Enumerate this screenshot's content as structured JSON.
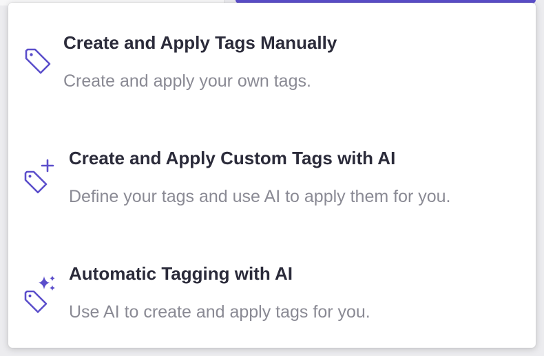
{
  "colors": {
    "accent": "#5b4ecb",
    "title": "#2b2b3a",
    "description": "#8a8a94",
    "menu_background": "#ffffff"
  },
  "menu": {
    "items": [
      {
        "icon": "tag-icon",
        "title": "Create and Apply Tags Manually",
        "description": "Create and apply your own tags."
      },
      {
        "icon": "tag-plus-icon",
        "title": "Create and Apply Custom Tags with AI",
        "description": "Define your tags and use AI to apply them for you."
      },
      {
        "icon": "tag-sparkle-icon",
        "title": "Automatic Tagging with AI",
        "description": "Use AI to create and apply tags for you."
      }
    ]
  }
}
